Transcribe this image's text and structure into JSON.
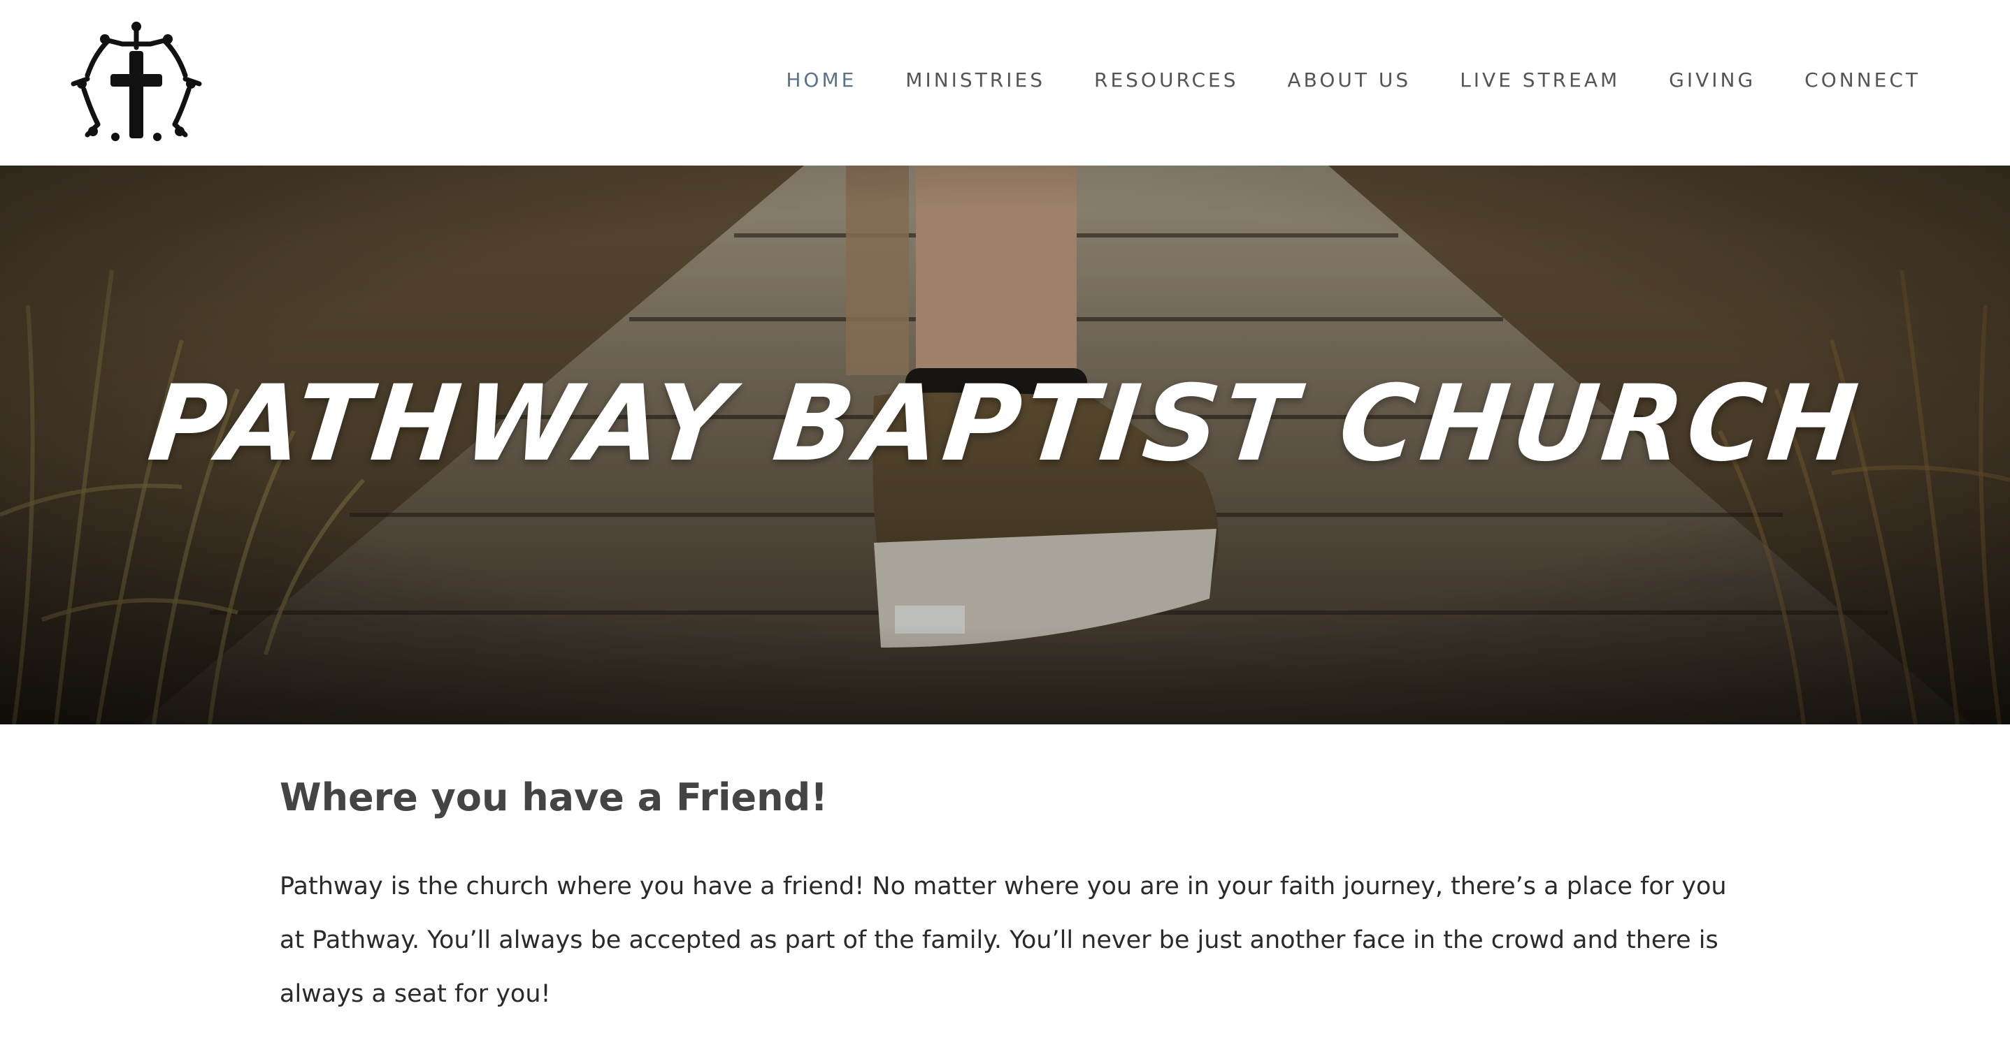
{
  "logo": {
    "icon": "cross-with-people-icon"
  },
  "nav": {
    "items": [
      {
        "label": "HOME",
        "active": true
      },
      {
        "label": "MINISTRIES",
        "active": false
      },
      {
        "label": "RESOURCES",
        "active": false
      },
      {
        "label": "ABOUT US",
        "active": false
      },
      {
        "label": "LIVE STREAM",
        "active": false
      },
      {
        "label": "GIVING",
        "active": false
      },
      {
        "label": "CONNECT",
        "active": false
      }
    ],
    "active_color": "#5b7289"
  },
  "hero": {
    "title": "PATHWAY BAPTIST CHURCH",
    "image": "sneaker-on-wooden-boardwalk"
  },
  "content": {
    "heading": "Where you have a Friend!",
    "body": "Pathway is the church where you have a friend! No matter where you are in your faith journey, there’s a place for you at Pathway. You’ll always be accepted as part of the family. You’ll never be just another face in the crowd and there is always a seat for you!"
  }
}
